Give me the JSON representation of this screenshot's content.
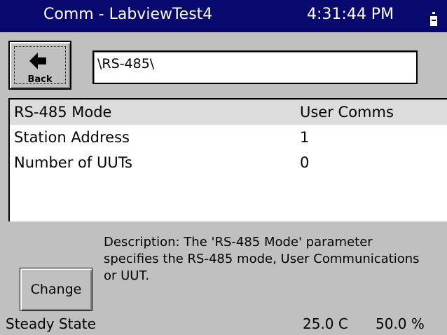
{
  "window": {
    "title": "Comm - LabviewTest4",
    "time": "4:31:44 PM",
    "battery_icon": "battery-icon"
  },
  "toolbar": {
    "back_label": "Back",
    "back_icon": "arrow-left-icon",
    "path": "\\RS-485\\"
  },
  "parameters": [
    {
      "label": "RS-485 Mode",
      "value": "User Comms",
      "selected": true
    },
    {
      "label": "Station Address",
      "value": "1",
      "selected": false
    },
    {
      "label": "Number of UUTs",
      "value": "0",
      "selected": false
    }
  ],
  "description": {
    "line1": "Description:  The 'RS-485 Mode' parameter",
    "line2": "specifies the RS-485 mode, User Communications",
    "line3": "or UUT."
  },
  "actions": {
    "change_label": "Change"
  },
  "status": {
    "state": "Steady State",
    "temperature": "25.0 C",
    "humidity": "50.0 %"
  },
  "colors": {
    "titlebar": "#08086e",
    "background": "#c0c0c0",
    "selected_row": "#dcdcdc"
  }
}
